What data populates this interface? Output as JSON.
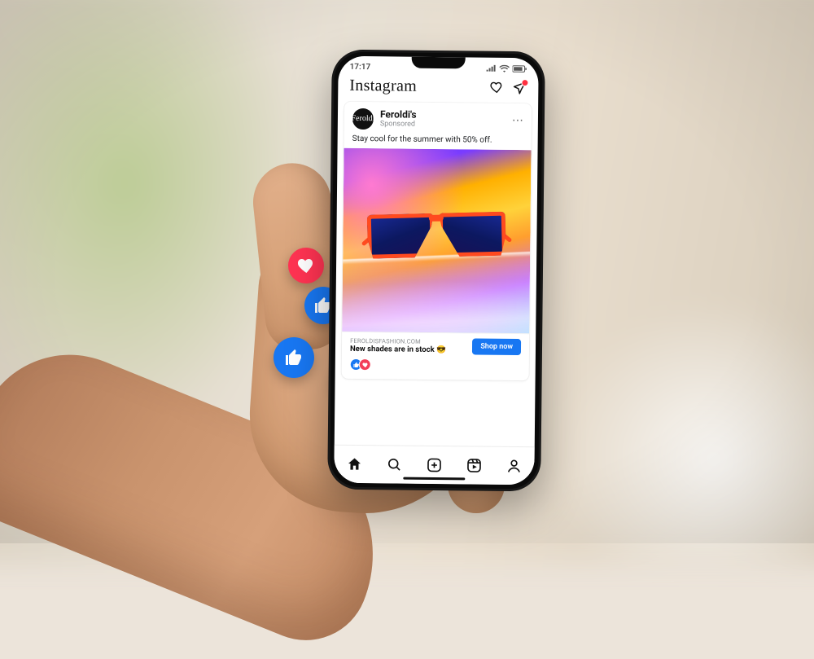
{
  "status": {
    "time": "17:17"
  },
  "header": {
    "app_name": "Instagram"
  },
  "post": {
    "advertiser": "Feroldi's",
    "avatar_text": "Feroldi",
    "sponsored_label": "Sponsored",
    "caption": "Stay cool for the summer with 50% off.",
    "domain": "FEROLDISFASHION.COM",
    "headline": "New shades are in stock 😎",
    "cta_label": "Shop now"
  },
  "colors": {
    "fb_blue": "#1877f2",
    "love_red": "#ff3352"
  }
}
